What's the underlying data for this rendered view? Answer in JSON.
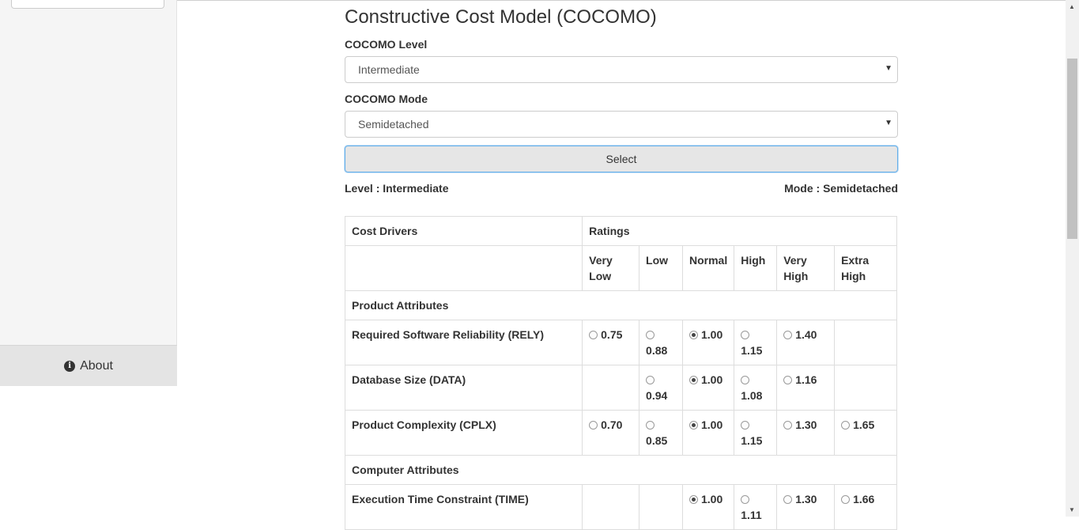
{
  "sidebar": {
    "about_label": "About"
  },
  "page": {
    "title": "Constructive Cost Model (COCOMO)"
  },
  "form": {
    "level_label": "COCOMO Level",
    "level_value": "Intermediate",
    "mode_label": "COCOMO Mode",
    "mode_value": "Semidetached",
    "select_button": "Select"
  },
  "summary": {
    "level": "Level : Intermediate",
    "mode": "Mode : Semidetached"
  },
  "table": {
    "header_cost_drivers": "Cost Drivers",
    "header_ratings": "Ratings",
    "ratings": [
      "Very Low",
      "Low",
      "Normal",
      "High",
      "Very High",
      "Extra High"
    ],
    "groups": [
      {
        "title": "Product Attributes",
        "rows": [
          {
            "name": "Required Software Reliability (RELY)",
            "values": [
              "0.75",
              "0.88",
              "1.00",
              "1.15",
              "1.40",
              ""
            ],
            "selected": 2
          },
          {
            "name": "Database Size (DATA)",
            "values": [
              "",
              "0.94",
              "1.00",
              "1.08",
              "1.16",
              ""
            ],
            "selected": 2
          },
          {
            "name": "Product Complexity (CPLX)",
            "values": [
              "0.70",
              "0.85",
              "1.00",
              "1.15",
              "1.30",
              "1.65"
            ],
            "selected": 2
          }
        ]
      },
      {
        "title": "Computer Attributes",
        "rows": [
          {
            "name": "Execution Time Constraint (TIME)",
            "values": [
              "",
              "",
              "1.00",
              "1.11",
              "1.30",
              "1.66"
            ],
            "selected": 2
          }
        ]
      }
    ]
  }
}
